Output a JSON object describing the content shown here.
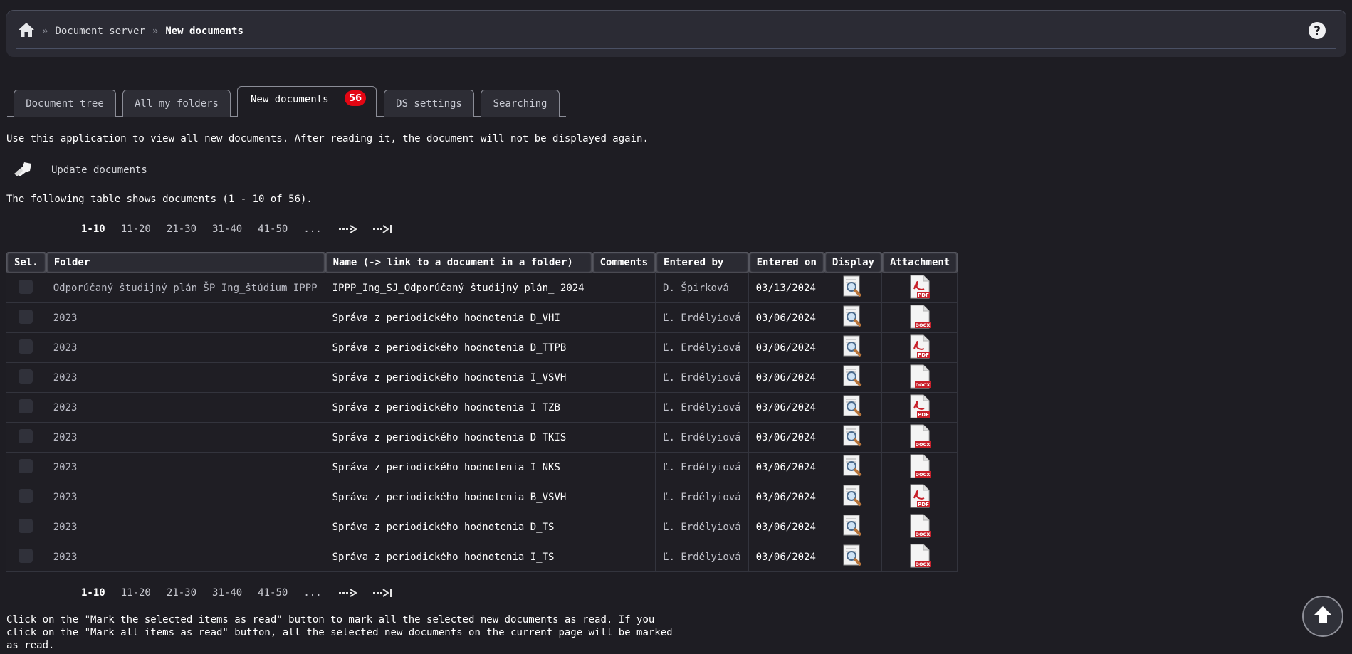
{
  "breadcrumb": {
    "sep": "»",
    "items": [
      "Document server",
      "New documents"
    ]
  },
  "tabs": [
    {
      "label": "Document tree"
    },
    {
      "label": "All my folders"
    },
    {
      "label": "New documents",
      "badge": "56",
      "active": true
    },
    {
      "label": "DS settings"
    },
    {
      "label": "Searching"
    }
  ],
  "info_text": "Use this application to view all new documents. After reading it, the document will not be displayed again.",
  "update_label": "Update documents",
  "shows_text": "The following table shows documents (1 - 10 of 56).",
  "pager": [
    "1-10",
    "11-20",
    "21-30",
    "31-40",
    "41-50",
    "..."
  ],
  "columns": [
    "Sel.",
    "Folder",
    "Name (-> link to a document in a folder)",
    "Comments",
    "Entered by",
    "Entered on",
    "Display",
    "Attachment"
  ],
  "rows": [
    {
      "folder": "Odporúčaný študijný plán ŠP Ing_štúdium IPPP",
      "name": "IPPP_Ing_SJ_Odporúčaný študijný plán_ 2024",
      "comments": "",
      "author": "D. Špirková",
      "date": "03/13/2024",
      "attachment": "PDF"
    },
    {
      "folder": "2023",
      "name": "Správa z periodického hodnotenia D_VHI",
      "comments": "",
      "author": "Ľ. Erdélyiová",
      "date": "03/06/2024",
      "attachment": "DOCX"
    },
    {
      "folder": "2023",
      "name": "Správa z periodického hodnotenia D_TTPB",
      "comments": "",
      "author": "Ľ. Erdélyiová",
      "date": "03/06/2024",
      "attachment": "PDF"
    },
    {
      "folder": "2023",
      "name": "Správa z periodického hodnotenia I_VSVH",
      "comments": "",
      "author": "Ľ. Erdélyiová",
      "date": "03/06/2024",
      "attachment": "DOCX"
    },
    {
      "folder": "2023",
      "name": "Správa z periodického hodnotenia I_TZB",
      "comments": "",
      "author": "Ľ. Erdélyiová",
      "date": "03/06/2024",
      "attachment": "PDF"
    },
    {
      "folder": "2023",
      "name": "Správa z periodického hodnotenia D_TKIS",
      "comments": "",
      "author": "Ľ. Erdélyiová",
      "date": "03/06/2024",
      "attachment": "DOCX"
    },
    {
      "folder": "2023",
      "name": "Správa z periodického hodnotenia I_NKS",
      "comments": "",
      "author": "Ľ. Erdélyiová",
      "date": "03/06/2024",
      "attachment": "DOCX"
    },
    {
      "folder": "2023",
      "name": "Správa z periodického hodnotenia B_VSVH",
      "comments": "",
      "author": "Ľ. Erdélyiová",
      "date": "03/06/2024",
      "attachment": "PDF"
    },
    {
      "folder": "2023",
      "name": "Správa z periodického hodnotenia D_TS",
      "comments": "",
      "author": "Ľ. Erdélyiová",
      "date": "03/06/2024",
      "attachment": "DOCX"
    },
    {
      "folder": "2023",
      "name": "Správa z periodického hodnotenia I_TS",
      "comments": "",
      "author": "Ľ. Erdélyiová",
      "date": "03/06/2024",
      "attachment": "DOCX"
    }
  ],
  "bottom_note": "Click on the \"Mark the selected items as read\" button to mark all the selected new documents as read. If you click on the \"Mark all items as read\" button, all the selected new documents on the current page will be marked as read.",
  "icons": {
    "home": "home-icon",
    "help": "help-icon",
    "update": "update-icon",
    "display": "magnifier-icon",
    "pdf": "pdf-icon",
    "docx": "docx-icon",
    "next": "next-page-icon",
    "last": "last-page-icon",
    "scroll_top": "arrow-up-icon"
  },
  "colors": {
    "background": "#1e1d23",
    "badge": "#e30613",
    "pdf_red": "#c8202a"
  }
}
